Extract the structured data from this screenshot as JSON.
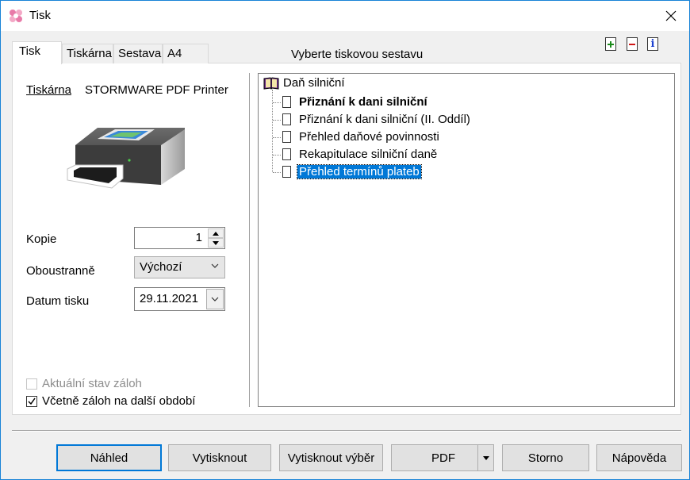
{
  "window": {
    "title": "Tisk"
  },
  "tabs": [
    {
      "label": "Tisk",
      "active": true
    },
    {
      "label": "Tiskárna",
      "active": false
    },
    {
      "label": "Sestava",
      "active": false
    },
    {
      "label": "A4",
      "active": false
    }
  ],
  "toolbar": {
    "icons": [
      "add-icon",
      "remove-icon",
      "info-icon"
    ],
    "info_glyph": "i"
  },
  "printer": {
    "label": "Tiskárna",
    "name": "STORMWARE PDF Printer"
  },
  "copies": {
    "label": "Kopie",
    "value": "1"
  },
  "duplex": {
    "label": "Oboustranně",
    "value": "Výchozí"
  },
  "print_date": {
    "label": "Datum tisku",
    "value": "29.11.2021"
  },
  "options": {
    "current_advances": {
      "label": "Aktuální stav záloh",
      "checked": false,
      "enabled": false
    },
    "include_next_period": {
      "label": "Včetně záloh na další období",
      "checked": true,
      "enabled": true
    }
  },
  "report_section": {
    "title": "Vyberte tiskovou sestavu"
  },
  "report_tree": {
    "root": "Daň silniční",
    "items": [
      {
        "label": "Přiznání k dani silniční",
        "bold": true,
        "selected": false
      },
      {
        "label": "Přiznání k dani silniční (II. Oddíl)",
        "bold": false,
        "selected": false
      },
      {
        "label": "Přehled daňové povinnosti",
        "bold": false,
        "selected": false
      },
      {
        "label": "Rekapitulace silniční daně",
        "bold": false,
        "selected": false
      },
      {
        "label": "Přehled termínů plateb",
        "bold": false,
        "selected": true
      }
    ]
  },
  "buttons": {
    "preview": "Náhled",
    "print": "Vytisknout",
    "print_selection": "Vytisknout výběr",
    "pdf": "PDF",
    "cancel": "Storno",
    "help": "Nápověda"
  },
  "colors": {
    "accent": "#0078d7",
    "window_border": "#1883d7",
    "selection": "#0078d7"
  }
}
